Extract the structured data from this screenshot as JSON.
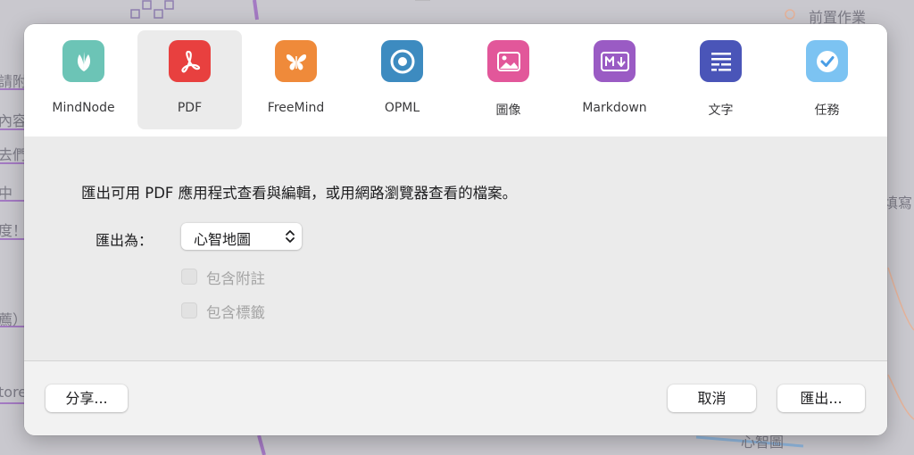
{
  "background": {
    "nodes": [
      "前置作業",
      "填寫",
      "心智圖"
    ],
    "edge_fragments": [
      "請附",
      "內容",
      "去們",
      "中",
      "度！",
      "薦）",
      "tore"
    ]
  },
  "dialog": {
    "formats": [
      {
        "label": "MindNode",
        "icon": "mindnode-leaf-icon",
        "color": "#6cc4b6",
        "selected": false
      },
      {
        "label": "PDF",
        "icon": "pdf-icon",
        "color": "#e8403f",
        "selected": true
      },
      {
        "label": "FreeMind",
        "icon": "butterfly-icon",
        "color": "#ef8a3a",
        "selected": false
      },
      {
        "label": "OPML",
        "icon": "opml-target-icon",
        "color": "#3d8bc0",
        "selected": false
      },
      {
        "label": "圖像",
        "icon": "image-icon",
        "color": "#e2579a",
        "selected": false
      },
      {
        "label": "Markdown",
        "icon": "markdown-icon",
        "color": "#9a5bc4",
        "selected": false
      },
      {
        "label": "文字",
        "icon": "text-lines-icon",
        "color": "#4a55b8",
        "selected": false
      },
      {
        "label": "任務",
        "icon": "checkmark-icon",
        "color": "#7cc3f2",
        "selected": false
      }
    ],
    "description": "匯出可用 PDF 應用程式查看與編輯，或用網路瀏覽器查看的檔案。",
    "export_as_label": "匯出為：",
    "export_as_value": "心智地圖",
    "options": [
      {
        "label": "包含附註",
        "checked": false,
        "enabled": false
      },
      {
        "label": "包含標籤",
        "checked": false,
        "enabled": false
      }
    ],
    "buttons": {
      "share": "分享...",
      "cancel": "取消",
      "export": "匯出..."
    }
  }
}
